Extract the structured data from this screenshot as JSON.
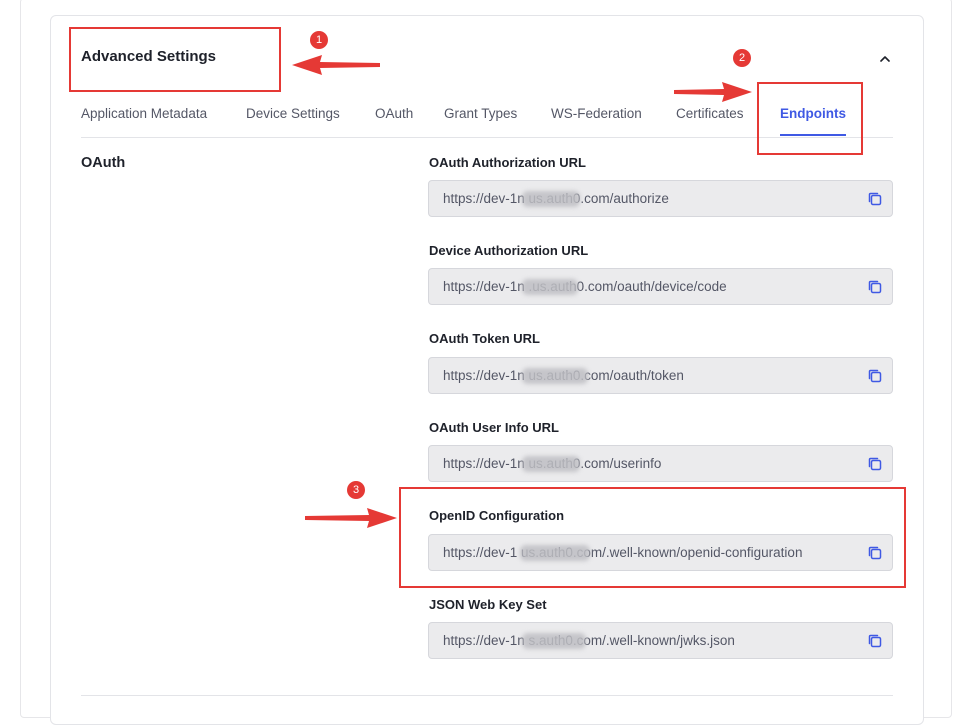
{
  "header": {
    "title": "Advanced Settings"
  },
  "tabs": [
    {
      "label": "Application Metadata"
    },
    {
      "label": "Device Settings"
    },
    {
      "label": "OAuth"
    },
    {
      "label": "Grant Types"
    },
    {
      "label": "WS-Federation"
    },
    {
      "label": "Certificates"
    },
    {
      "label": "Endpoints",
      "active": true
    }
  ],
  "section": {
    "label": "OAuth"
  },
  "fields": [
    {
      "label": "OAuth Authorization URL",
      "value": "https://dev-1n        us.auth0.com/authorize"
    },
    {
      "label": "Device Authorization URL",
      "value": "https://dev-1n        .us.auth0.com/oauth/device/code"
    },
    {
      "label": "OAuth Token URL",
      "value": "https://dev-1n        us.auth0.com/oauth/token"
    },
    {
      "label": "OAuth User Info URL",
      "value": "https://dev-1n        us.auth0.com/userinfo"
    },
    {
      "label": "OpenID Configuration",
      "value": "https://dev-1        us.auth0.com/.well-known/openid-configuration"
    },
    {
      "label": "JSON Web Key Set",
      "value": "https://dev-1n        s.auth0.com/.well-known/jwks.json"
    }
  ],
  "annotations": {
    "markers": [
      "1",
      "2",
      "3"
    ]
  },
  "colors": {
    "accent": "#3f59e4",
    "annotation": "#e53935"
  }
}
